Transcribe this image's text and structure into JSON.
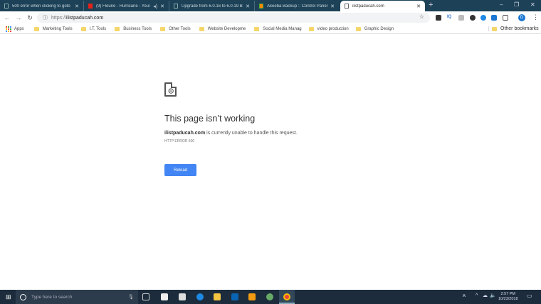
{
  "browser": {
    "tabs": [
      {
        "title": "500 error when clicking to goto"
      },
      {
        "title": "(9) Fleurie - Hurricane - YouT"
      },
      {
        "title": "Upgrade from 6.0.16 to 6.0.19 Br"
      },
      {
        "title": "Akeeba Backup :: Control Panel"
      },
      {
        "title": "ilistpaducah.com"
      }
    ],
    "address": {
      "protocol": "https://",
      "host": "ilistpaducah.com"
    },
    "profile_initial": "D",
    "bookmarks": [
      "Apps",
      "Marketing Tools",
      "I.T. Tools",
      "Business Tools",
      "Other Tools",
      "Website Developme",
      "Social Media Manag",
      "video production",
      "Graphic Design"
    ],
    "other_bookmarks": "Other bookmarks"
  },
  "error_page": {
    "title": "This page isn’t working",
    "host": "ilistpaducah.com",
    "message": " is currently unable to handle this request.",
    "code": "HTTP ERROR 500",
    "reload_label": "Reload",
    "accent": "#4285f4"
  },
  "taskbar": {
    "search_placeholder": "Type here to search",
    "time": "2:57 PM",
    "date": "10/23/2018"
  }
}
